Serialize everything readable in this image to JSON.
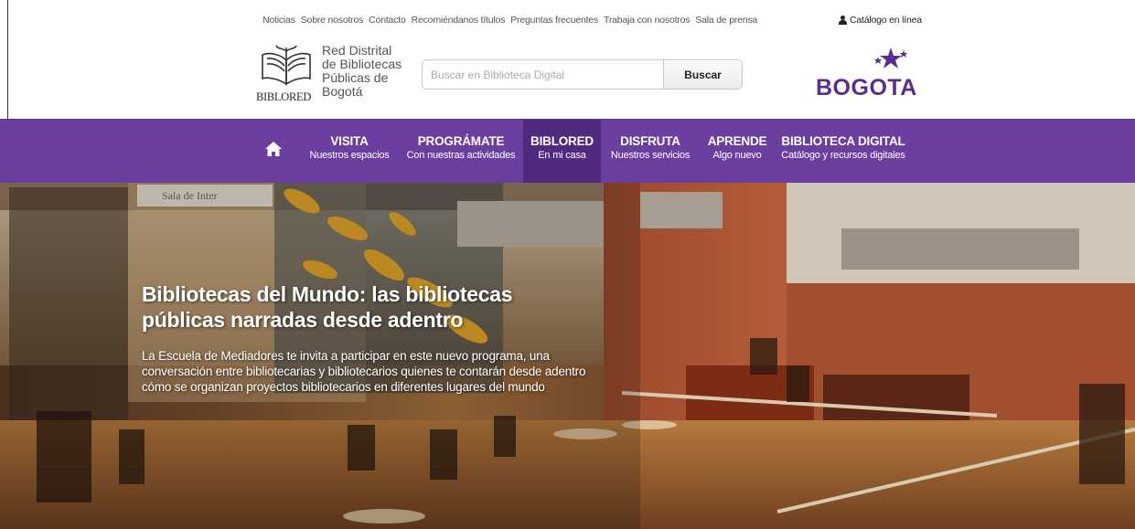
{
  "top_links": [
    "Noticias",
    "Sobre nosotros",
    "Contacto",
    "Recomiéndanos títulos",
    "Preguntas frecuentes",
    "Trabaja con nosotros",
    "Sala de prensa"
  ],
  "catalog_link": "Catálogo en línea",
  "logo": {
    "wordmark": "BIBLORED",
    "lines": [
      "Red Distrital",
      "de Bibliotecas",
      "Públicas de",
      "Bogotá"
    ]
  },
  "search": {
    "placeholder": "Buscar en Biblioteca Digital",
    "button": "Buscar"
  },
  "bogota_logo": "BOGOTA",
  "nav": [
    {
      "title": "VISITA",
      "subtitle": "Nuestros espacios"
    },
    {
      "title": "PROGRÁMATE",
      "subtitle": "Con nuestras actividades"
    },
    {
      "title": "BIBLORED",
      "subtitle": "En mi casa",
      "active": true
    },
    {
      "title": "DISFRUTA",
      "subtitle": "Nuestros servicios"
    },
    {
      "title": "APRENDE",
      "subtitle": "Algo nuevo"
    },
    {
      "title": "BIBLIOTECA DIGITAL",
      "subtitle": "Catálogo y recursos digitales"
    }
  ],
  "hero": {
    "title_line1": "Bibliotecas del Mundo: las bibliotecas",
    "title_line2": "públicas narradas desde adentro",
    "description": "La Escuela de Mediadores te invita a participar en este nuevo programa, una conversación entre bibliotecarias y bibliotecarios quienes te contarán desde adentro cómo se organizan proyectos bibliotecarios en diferentes lugares del mundo",
    "sign_text": "Sala de Inter"
  },
  "colors": {
    "nav_bg": "#6a3fa0",
    "nav_active": "#4f2a7e",
    "bogota_purple": "#5b2d8e"
  }
}
